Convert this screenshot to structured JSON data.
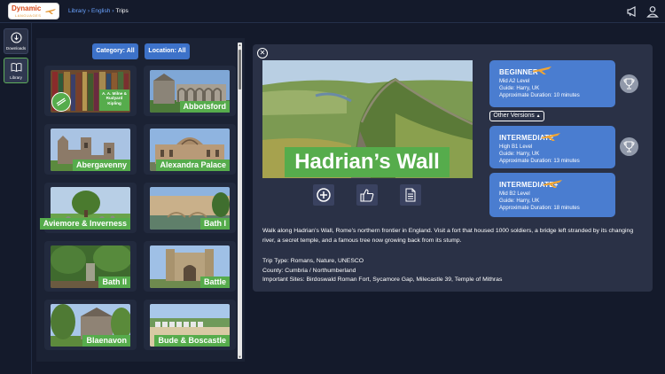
{
  "header": {
    "logo_text": "Dynamic",
    "logo_sub": "LANGUAGES",
    "breadcrumb": [
      "Library",
      "English",
      "Trips"
    ],
    "announcements_icon": "megaphone-icon",
    "profile_icon": "user-icon"
  },
  "sidebar": {
    "items": [
      {
        "label": "Downloads",
        "icon": "download-icon"
      },
      {
        "label": "Library",
        "icon": "book-icon"
      }
    ]
  },
  "filters": {
    "category": "Category: All",
    "location": "Location: All"
  },
  "trips": [
    {
      "label": "Abbotsford"
    },
    {
      "label": "Abergavenny"
    },
    {
      "label": "Alexandra Palace"
    },
    {
      "label": "Aviemore & Inverness"
    },
    {
      "label": "Bath I"
    },
    {
      "label": "Bath II"
    },
    {
      "label": "Battle"
    },
    {
      "label": "Blaenavon"
    },
    {
      "label": "Bude & Boscastle"
    }
  ],
  "first_card_badge": "A. A. Milne & Rudyard Kipling",
  "detail": {
    "title": "Hadrian’s Wall",
    "description": "Walk along Hadrian’s Wall, Rome’s northern frontier in England. Visit a fort that housed 1000 soldiers, a bridge left stranded by its changing river, a secret temple, and a famous tree now growing back from its stump.",
    "trip_type": "Trip Type: Romans, Nature, UNESCO",
    "county": "County: Cumbria / Northumberland",
    "important_sites": "Important Sites: Birdoswald Roman Fort, Sycamore Gap, Milecastle 39, Temple of Mithras",
    "other_versions": "Other Versions"
  },
  "levels": [
    {
      "title": "BEGINNER",
      "level": "Mid A2 Level",
      "guide": "Guide: Harry, UK",
      "duration": "Approximate Duration: 10 minutes"
    },
    {
      "title": "INTERMEDIATE",
      "level": "High B1 Level",
      "guide": "Guide: Harry, UK",
      "duration": "Approximate Duration: 13 minutes"
    },
    {
      "title": "INTERMEDIATE+",
      "level": "Mid B2 Level",
      "guide": "Guide: Harry, UK",
      "duration": "Approximate Duration: 18 minutes"
    }
  ],
  "colors": {
    "accent_green": "#56ac4c",
    "accent_blue": "#4a7dd0",
    "background": "#141a2b",
    "panel": "#2a3146"
  }
}
